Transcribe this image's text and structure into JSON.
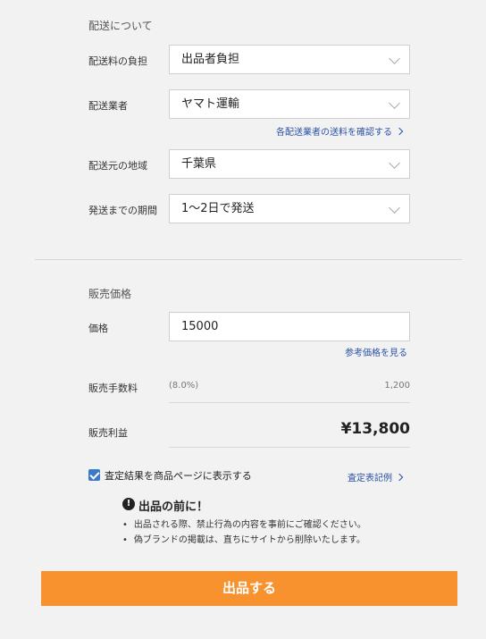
{
  "shipping": {
    "section_title": "配送について",
    "fee_label": "配送料の負担",
    "fee_value": "出品者負担",
    "carrier_label": "配送業者",
    "carrier_value": "ヤマト運輸",
    "carrier_link": "各配送業者の送料を確認する",
    "origin_label": "配送元の地域",
    "origin_value": "千葉県",
    "days_label": "発送までの期間",
    "days_value": "1〜2日で発送"
  },
  "price": {
    "section_title": "販売価格",
    "price_label": "価格",
    "price_value": "15000",
    "reference_link": "参考価格を見る",
    "fee_label": "販売手数料",
    "fee_rate": "(8.0%)",
    "fee_amount": "1,200",
    "profit_label": "販売利益",
    "profit_amount": "¥13,800"
  },
  "assessment": {
    "checkbox_label": "査定結果を商品ページに表示する",
    "checked": true,
    "example_link": "査定表記例"
  },
  "notice": {
    "icon": "exclamation-icon",
    "title": "出品の前に！",
    "items": [
      "出品される際、禁止行為の内容を事前にご確認ください。",
      "偽ブランドの掲載は、直ちにサイトから削除いたします。"
    ]
  },
  "submit_label": "出品する",
  "colors": {
    "accent": "#f7922e",
    "link": "#2b52a6",
    "checkbox": "#3b79c9"
  }
}
